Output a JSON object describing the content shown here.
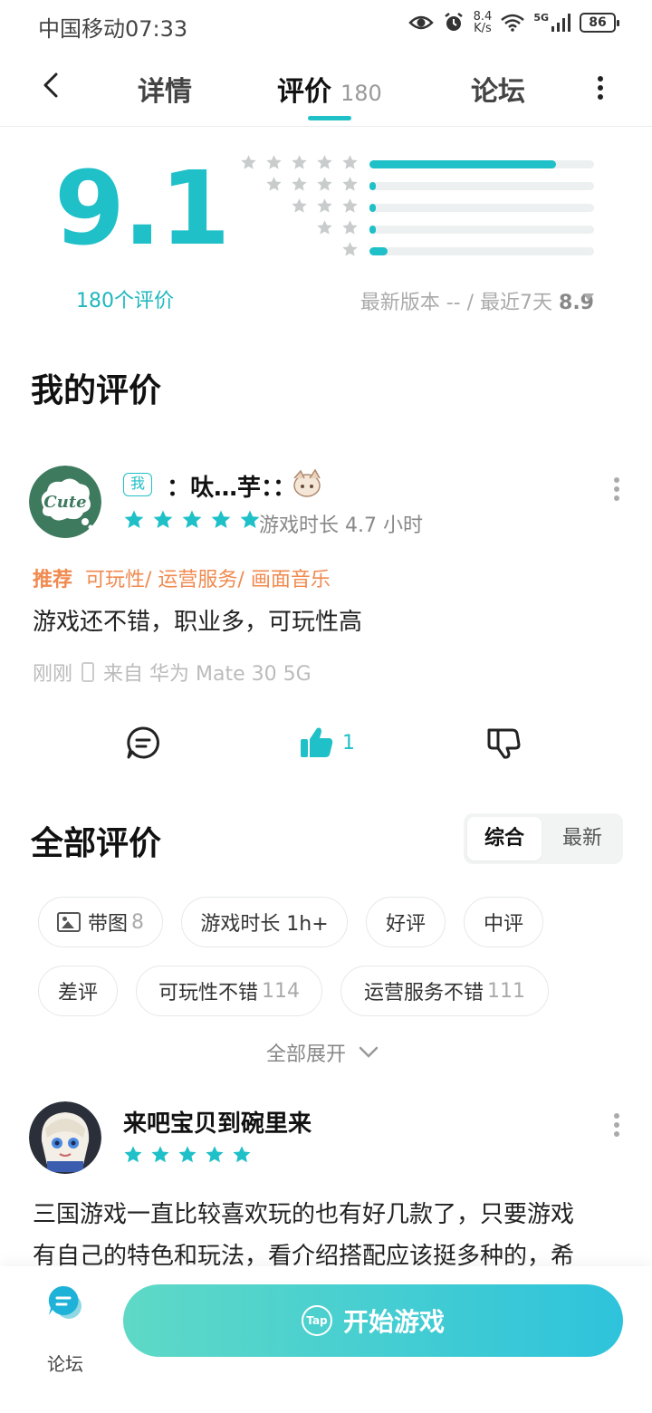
{
  "status_bar": {
    "carrier": "中国移动",
    "time": "07:33",
    "net_speed_value": "8.4",
    "net_speed_unit": "K/s",
    "network": "5G",
    "battery": "86"
  },
  "nav": {
    "tabs": [
      {
        "label": "详情"
      },
      {
        "label": "评价",
        "count": "180"
      },
      {
        "label": "论坛"
      }
    ]
  },
  "rating": {
    "score": "9.1",
    "count_label": "180个评价",
    "distribution": [
      {
        "stars": 5,
        "fraction": 0.83
      },
      {
        "stars": 4,
        "fraction": 0.03
      },
      {
        "stars": 3,
        "fraction": 0.03
      },
      {
        "stars": 2,
        "fraction": 0.03
      },
      {
        "stars": 1,
        "fraction": 0.08
      }
    ],
    "version_text": "最新版本 -- / 最近7天",
    "recent_score": "8.9"
  },
  "my_review": {
    "section_title": "我的评价",
    "me_tag": "我",
    "nickname": "：呔…芋：：",
    "stars": 5,
    "playtime": "游戏时长 4.7 小时",
    "recommend_label": "推荐",
    "recommend_tags": "可玩性/ 运营服务/ 画面音乐",
    "content": "游戏还不错，职业多，可玩性高",
    "time": "刚刚",
    "device": "来自 华为 Mate 30 5G",
    "like_count": "1"
  },
  "all_reviews": {
    "section_title": "全部评价",
    "sort_options": [
      "综合",
      "最新"
    ],
    "filters": [
      {
        "label": "带图",
        "count": "8",
        "icon": "image-icon"
      },
      {
        "label": "游戏时长 1h+"
      },
      {
        "label": "好评"
      },
      {
        "label": "中评"
      },
      {
        "label": "差评"
      },
      {
        "label": "可玩性不错",
        "count": "114"
      },
      {
        "label": "运营服务不错",
        "count": "111"
      }
    ],
    "expand_label": "全部展开",
    "reviews": [
      {
        "nickname": "来吧宝贝到碗里来",
        "stars": 5,
        "content_line1": "三国游戏一直比较喜欢玩的也有好几款了，只要游戏",
        "content_line2": "有自己的特色和玩法，看介绍搭配应该挺多种的，希"
      }
    ]
  },
  "bottom_bar": {
    "forum_label": "论坛",
    "start_label": "开始游戏",
    "brand_logo": "Tap"
  },
  "colors": {
    "accent": "#1fc0c8",
    "recommend": "#f08a50"
  }
}
